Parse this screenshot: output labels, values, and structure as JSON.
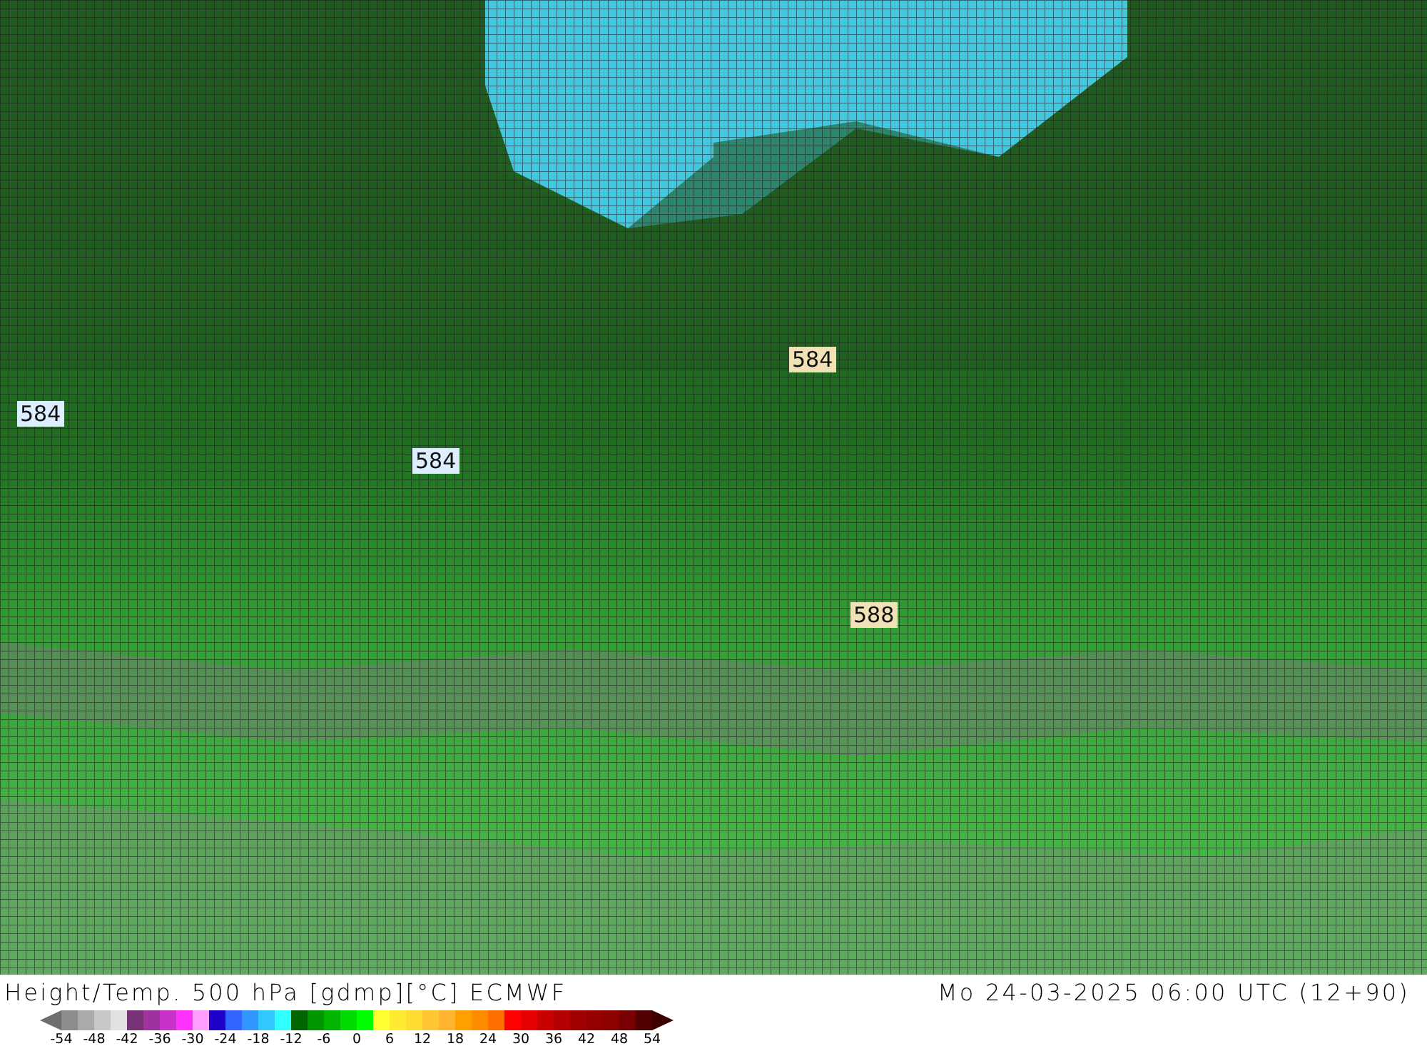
{
  "map": {
    "contour_labels": [
      {
        "text": "584",
        "color": "#dceeff"
      },
      {
        "text": "584",
        "color": "#dceeff"
      },
      {
        "text": "584",
        "color": "#f0e2b4"
      },
      {
        "text": "588",
        "color": "#f0e2b4"
      }
    ]
  },
  "title": "Height/Temp. 500 hPa [gdmp][°C] ECMWF",
  "valid_time": "Mo 24-03-2025 06:00 UTC (12+90)",
  "legend": {
    "swatches": [
      {
        "color": "#8c8c8c"
      },
      {
        "color": "#aaaaaa"
      },
      {
        "color": "#c8c8c8"
      },
      {
        "color": "#e1e1e1"
      },
      {
        "color": "#783278"
      },
      {
        "color": "#a032a0"
      },
      {
        "color": "#c832c8"
      },
      {
        "color": "#ff32ff"
      },
      {
        "color": "#ffa0ff"
      },
      {
        "color": "#1e00c8"
      },
      {
        "color": "#3264ff"
      },
      {
        "color": "#3296ff"
      },
      {
        "color": "#32c8ff"
      },
      {
        "color": "#32ffff"
      },
      {
        "color": "#006400"
      },
      {
        "color": "#009600"
      },
      {
        "color": "#00b400"
      },
      {
        "color": "#00dc00"
      },
      {
        "color": "#00ff00"
      },
      {
        "color": "#ffff32"
      },
      {
        "color": "#ffeb32"
      },
      {
        "color": "#ffdc32"
      },
      {
        "color": "#ffc832"
      },
      {
        "color": "#ffb432"
      },
      {
        "color": "#ffa000"
      },
      {
        "color": "#ff8c00"
      },
      {
        "color": "#ff6e00"
      },
      {
        "color": "#ff0000"
      },
      {
        "color": "#e60000"
      },
      {
        "color": "#c80000"
      },
      {
        "color": "#b40000"
      },
      {
        "color": "#a00000"
      },
      {
        "color": "#960000"
      },
      {
        "color": "#8c0000"
      },
      {
        "color": "#780000"
      },
      {
        "color": "#500000"
      }
    ],
    "ticks": [
      "-54",
      "-48",
      "-42",
      "-36",
      "-30",
      "-24",
      "-18",
      "-12",
      "-6",
      "0",
      "6",
      "12",
      "18",
      "24",
      "30",
      "36",
      "42",
      "48",
      "54"
    ]
  }
}
